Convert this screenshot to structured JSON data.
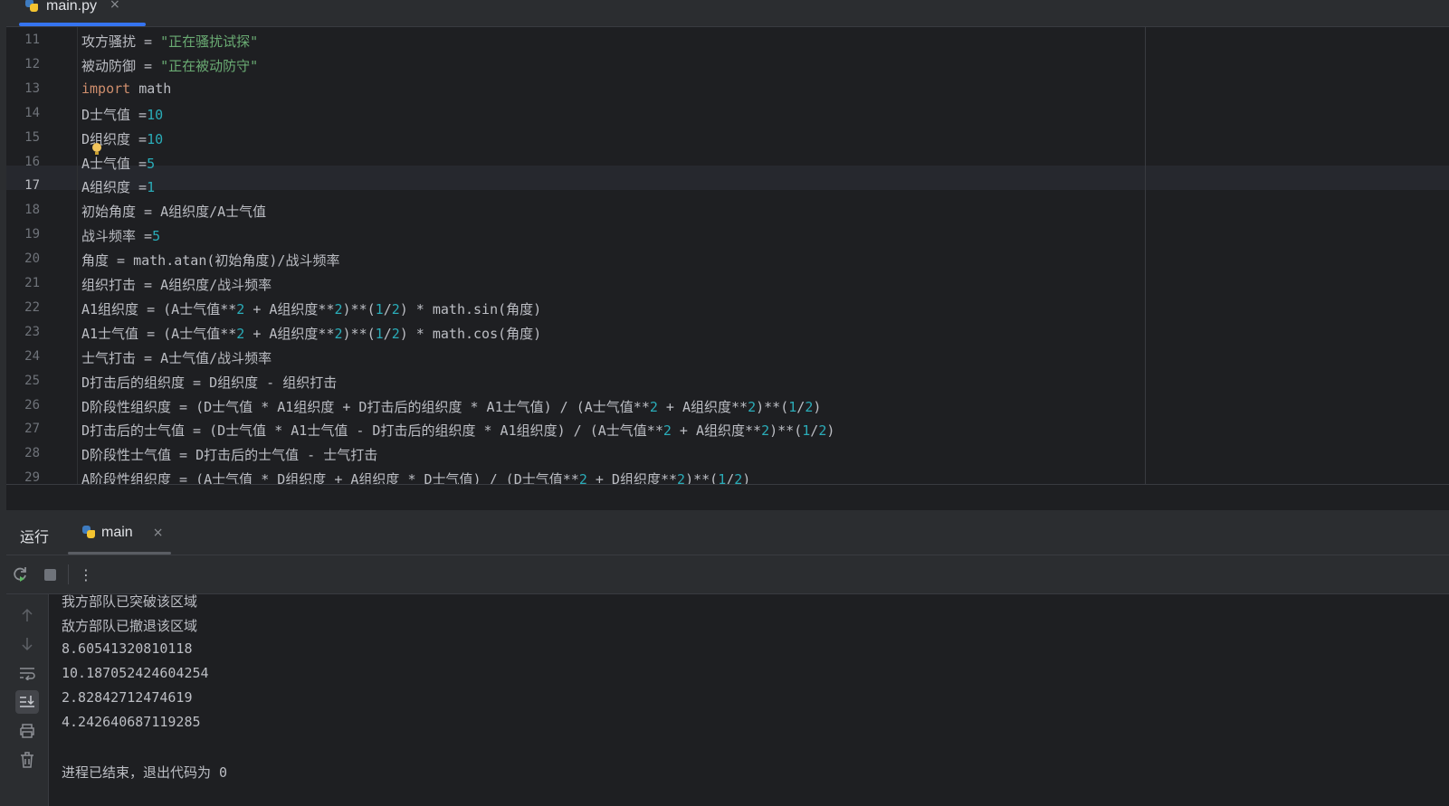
{
  "tab": {
    "filename": "main.py",
    "close": "×"
  },
  "editor": {
    "lines": [
      {
        "no": "11",
        "segments": [
          [
            "t",
            "攻方骚扰 = "
          ],
          [
            "s",
            "\"正在骚扰试探\""
          ]
        ]
      },
      {
        "no": "12",
        "segments": [
          [
            "t",
            "被动防御 = "
          ],
          [
            "s",
            "\"正在被动防守\""
          ]
        ]
      },
      {
        "no": "13",
        "segments": [
          [
            "k",
            "import"
          ],
          [
            "t",
            " math"
          ]
        ]
      },
      {
        "no": "14",
        "segments": [
          [
            "t",
            "D士气值 ="
          ],
          [
            "n",
            "10"
          ]
        ]
      },
      {
        "no": "15",
        "segments": [
          [
            "t",
            "D组织度 ="
          ],
          [
            "n",
            "10"
          ]
        ]
      },
      {
        "no": "16",
        "segments": [
          [
            "t",
            "A士气值 ="
          ],
          [
            "n",
            "5"
          ]
        ]
      },
      {
        "no": "17",
        "segments": [
          [
            "t",
            "A组织度 ="
          ],
          [
            "n",
            "1"
          ]
        ]
      },
      {
        "no": "18",
        "segments": [
          [
            "t",
            "初始角度 = A组织度/A士气值"
          ]
        ]
      },
      {
        "no": "19",
        "segments": [
          [
            "t",
            "战斗频率 ="
          ],
          [
            "n",
            "5"
          ]
        ]
      },
      {
        "no": "20",
        "segments": [
          [
            "t",
            "角度 = math.atan(初始角度)/战斗频率"
          ]
        ]
      },
      {
        "no": "21",
        "segments": [
          [
            "t",
            "组织打击 = A组织度/战斗频率"
          ]
        ]
      },
      {
        "no": "22",
        "segments": [
          [
            "t",
            "A1组织度 = (A士气值**"
          ],
          [
            "n",
            "2"
          ],
          [
            "t",
            " + A组织度**"
          ],
          [
            "n",
            "2"
          ],
          [
            "t",
            ")**("
          ],
          [
            "n",
            "1"
          ],
          [
            "t",
            "/"
          ],
          [
            "n",
            "2"
          ],
          [
            "t",
            ") * math.sin(角度)"
          ]
        ]
      },
      {
        "no": "23",
        "segments": [
          [
            "t",
            "A1士气值 = (A士气值**"
          ],
          [
            "n",
            "2"
          ],
          [
            "t",
            " + A组织度**"
          ],
          [
            "n",
            "2"
          ],
          [
            "t",
            ")**("
          ],
          [
            "n",
            "1"
          ],
          [
            "t",
            "/"
          ],
          [
            "n",
            "2"
          ],
          [
            "t",
            ") * math.cos(角度)"
          ]
        ]
      },
      {
        "no": "24",
        "segments": [
          [
            "t",
            "士气打击 = A士气值/战斗频率"
          ]
        ]
      },
      {
        "no": "25",
        "segments": [
          [
            "t",
            "D打击后的组织度 = D组织度 - 组织打击"
          ]
        ]
      },
      {
        "no": "26",
        "segments": [
          [
            "t",
            "D阶段性组织度 = (D士气值 * A1组织度 + D打击后的组织度 * A1士气值) / (A士气值**"
          ],
          [
            "n",
            "2"
          ],
          [
            "t",
            " + A组织度**"
          ],
          [
            "n",
            "2"
          ],
          [
            "t",
            ")**("
          ],
          [
            "n",
            "1"
          ],
          [
            "t",
            "/"
          ],
          [
            "n",
            "2"
          ],
          [
            "t",
            ")"
          ]
        ]
      },
      {
        "no": "27",
        "segments": [
          [
            "t",
            "D打击后的士气值 = (D士气值 * A1士气值 - D打击后的组织度 * A1组织度) / (A士气值**"
          ],
          [
            "n",
            "2"
          ],
          [
            "t",
            " + A组织度**"
          ],
          [
            "n",
            "2"
          ],
          [
            "t",
            ")**("
          ],
          [
            "n",
            "1"
          ],
          [
            "t",
            "/"
          ],
          [
            "n",
            "2"
          ],
          [
            "t",
            ")"
          ]
        ]
      },
      {
        "no": "28",
        "segments": [
          [
            "t",
            "D阶段性士气值 = D打击后的士气值 - 士气打击"
          ]
        ]
      },
      {
        "no": "29",
        "segments": [
          [
            "t",
            "A阶段性组织度 = (A士气值 * D组织度 + A组织度 * D士气值) / (D士气值**"
          ],
          [
            "n",
            "2"
          ],
          [
            "t",
            " + D组织度**"
          ],
          [
            "n",
            "2"
          ],
          [
            "t",
            ")**("
          ],
          [
            "n",
            "1"
          ],
          [
            "t",
            "/"
          ],
          [
            "n",
            "2"
          ],
          [
            "t",
            ")"
          ]
        ]
      }
    ],
    "active_line": "17"
  },
  "run_panel": {
    "title": "运行",
    "tab_label": "main",
    "tab_close": "×",
    "more_menu": "⋮"
  },
  "console": {
    "lines": [
      "我方部队已突破该区域",
      "敌方部队已撤退该区域",
      "8.60541320810118",
      "10.187052424604254",
      "2.82842712474619",
      "4.242640687119285",
      "",
      "进程已结束，退出代码为 0"
    ]
  },
  "icons": {
    "rerun": "rerun-icon",
    "stop": "stop-icon",
    "up": "arrow-up-icon",
    "down": "arrow-down-icon",
    "wrap": "soft-wrap-icon",
    "scroll_end": "scroll-to-end-icon",
    "print": "print-icon",
    "trash": "trash-icon"
  },
  "colors": {
    "keyword": "#cf8e6d",
    "number": "#2aacb8",
    "string": "#6aab73",
    "accent": "#3574f0"
  }
}
